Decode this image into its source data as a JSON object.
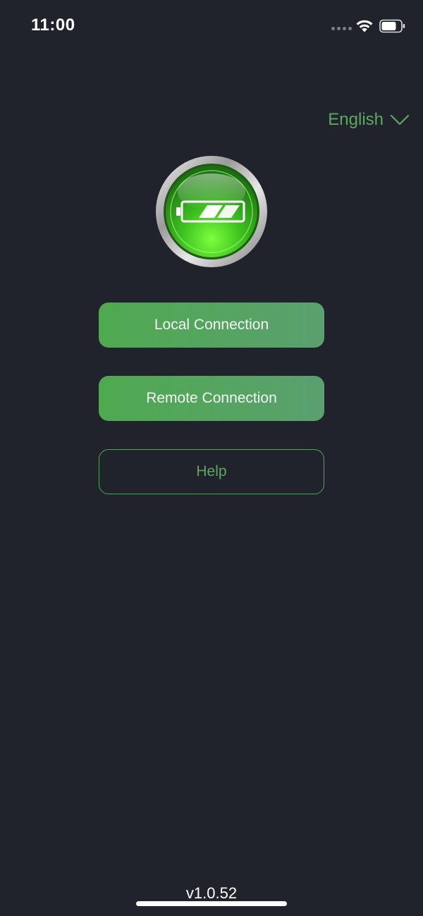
{
  "status_bar": {
    "time": "11:00",
    "icons": [
      "signal-dots-icon",
      "wifi-icon",
      "battery-icon"
    ]
  },
  "language": {
    "label": "English",
    "icon": "chevron-down-icon"
  },
  "logo": {
    "icon": "battery-logo-icon"
  },
  "buttons": {
    "local": "Local Connection",
    "remote": "Remote Connection",
    "help": "Help"
  },
  "footer": {
    "version": "v1.0.52"
  },
  "colors": {
    "background": "#21232c",
    "accent": "#5aa95c",
    "button_gradient_start": "#4fa94f",
    "button_gradient_end": "#5aa070",
    "text_light": "#ffffff"
  }
}
